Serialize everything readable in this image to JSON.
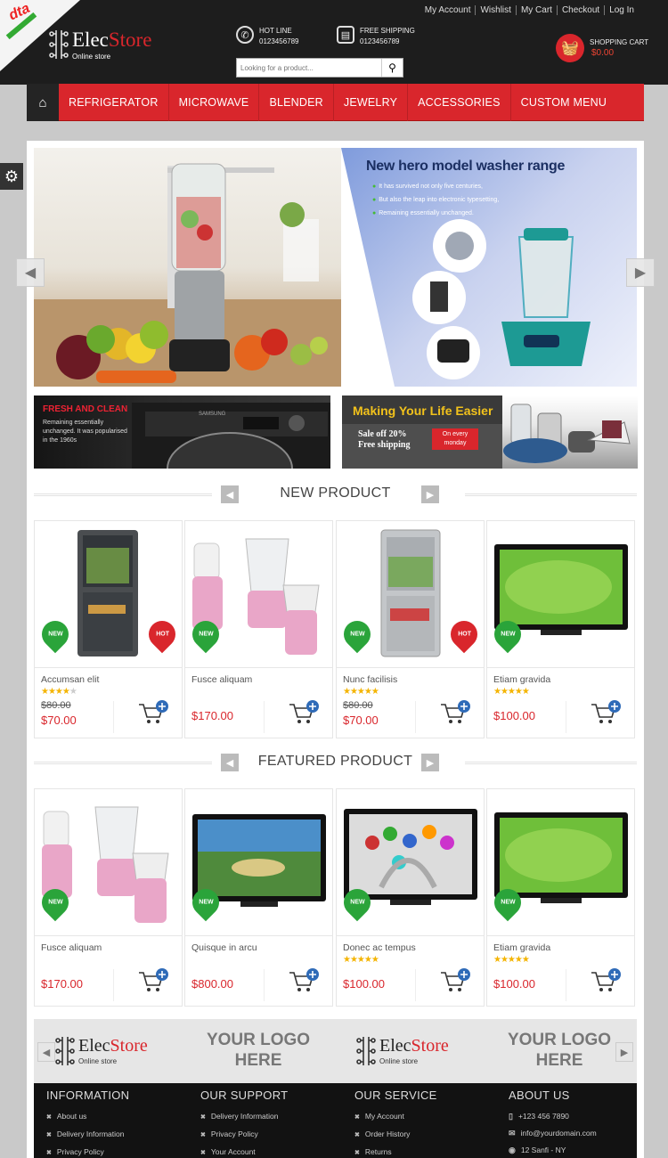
{
  "top_links": [
    "My Account",
    "Wishlist",
    "My Cart",
    "Checkout",
    "Log In"
  ],
  "corner_badge": "dta",
  "logo": {
    "part1": "Elec",
    "part2": "Store",
    "tagline": "Online store"
  },
  "hotline": {
    "label": "HOT LINE",
    "phone": "0123456789",
    "icon": "phone-icon"
  },
  "shipping": {
    "label": "FREE SHIPPING",
    "phone": "0123456789",
    "icon": "truck-icon"
  },
  "search": {
    "placeholder": "Looking for a product..."
  },
  "cart": {
    "label": "SHOPPING CART",
    "total": "$0.00"
  },
  "nav": [
    "REFRIGERATOR",
    "MICROWAVE",
    "BLENDER",
    "JEWELRY",
    "ACCESSORIES",
    "CUSTOM MENU"
  ],
  "slider": {
    "title": "New hero model washer range",
    "bullets": [
      "It has survived not only five centuries,",
      "But also the leap into electronic typesetting,",
      "Remaining essentially unchanged."
    ]
  },
  "banner_left": {
    "heading": "FRESH AND CLEAN",
    "text": "Remaining essentially unchanged. It was popularised in the 1960s",
    "brand": "SAMSUNG"
  },
  "banner_right": {
    "heading": "Making Your Life Easier",
    "line1": "Sale off 20%",
    "line2": "Free shipping",
    "tag": "On every monday"
  },
  "new_product": {
    "title": "NEW PRODUCT",
    "items": [
      {
        "name": "Accumsan elit",
        "stars": "★★★★",
        "stars_empty": "★",
        "old_price": "$80.00",
        "price": "$70.00",
        "new": "NEW",
        "hot": "HOT"
      },
      {
        "name": "Fusce aliquam",
        "stars": "",
        "stars_empty": "",
        "old_price": "",
        "price": "$170.00",
        "new": "NEW",
        "hot": ""
      },
      {
        "name": "Nunc facilisis",
        "stars": "★★★★★",
        "stars_empty": "",
        "old_price": "$80.00",
        "price": "$70.00",
        "new": "NEW",
        "hot": "HOT"
      },
      {
        "name": "Etiam gravida",
        "stars": "★★★★★",
        "stars_empty": "",
        "old_price": "",
        "price": "$100.00",
        "new": "NEW",
        "hot": ""
      }
    ]
  },
  "featured_product": {
    "title": "FEATURED PRODUCT",
    "items": [
      {
        "name": "Fusce aliquam",
        "stars": "",
        "old_price": "",
        "price": "$170.00",
        "new": "NEW"
      },
      {
        "name": "Quisque in arcu",
        "stars": "",
        "old_price": "",
        "price": "$800.00",
        "new": "NEW"
      },
      {
        "name": "Donec ac tempus",
        "stars": "★★★★★",
        "old_price": "",
        "price": "$100.00",
        "new": "NEW"
      },
      {
        "name": "Etiam gravida",
        "stars": "★★★★★",
        "old_price": "",
        "price": "$100.00",
        "new": "NEW"
      }
    ]
  },
  "brands": {
    "your_logo_1": "YOUR LOGO",
    "your_logo_2": "HERE"
  },
  "footer": {
    "information": {
      "title": "INFORMATION",
      "links": [
        "About us",
        "Delivery Information",
        "Privacy Policy"
      ]
    },
    "support": {
      "title": "OUR SUPPORT",
      "links": [
        "Delivery Information",
        "Privacy Policy",
        "Your Account"
      ]
    },
    "service": {
      "title": "OUR SERVICE",
      "links": [
        "My Account",
        "Order History",
        "Returns"
      ]
    },
    "about": {
      "title": "ABOUT US",
      "phone": "+123 456 7890",
      "email": "info@yourdomain.com",
      "address": "12 Sanfi - NY"
    }
  },
  "colors": {
    "brand_red": "#d9262c",
    "new_green": "#2aa43a",
    "header_dark": "#1d1d1d",
    "star_yellow": "#f4b400"
  }
}
